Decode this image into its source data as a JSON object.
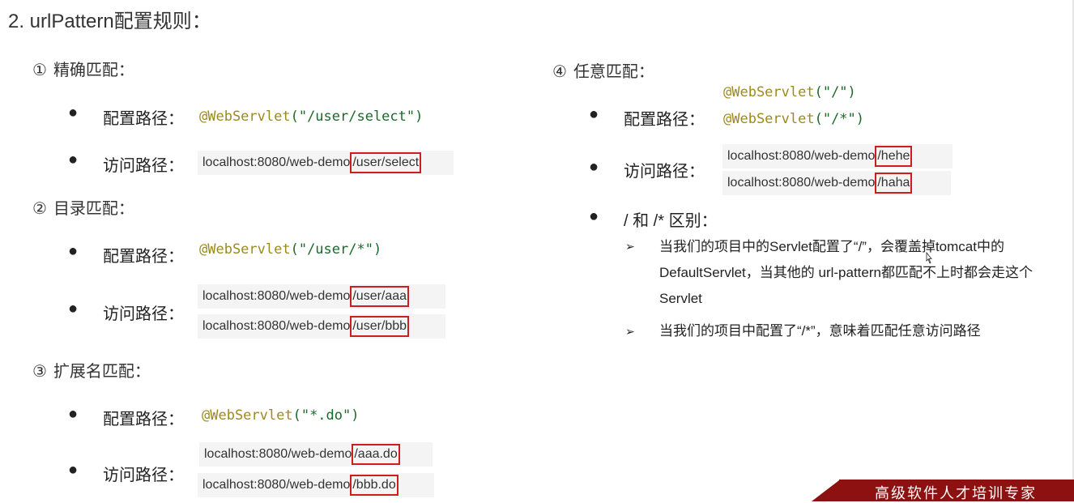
{
  "title": "2. urlPattern配置规则：",
  "sections": [
    {
      "num": "①",
      "heading": "精确匹配：",
      "config_label": "配置路径：",
      "config_lines": [
        {
          "anno": "@WebServlet",
          "arg": "(\"/user/select\")"
        }
      ],
      "access_label": "访问路径：",
      "urls": [
        {
          "host": "localhost:8080/web-demo",
          "path": "/user/select"
        }
      ]
    },
    {
      "num": "②",
      "heading": "目录匹配：",
      "config_label": "配置路径：",
      "config_lines": [
        {
          "anno": "@WebServlet",
          "arg": "(\"/user/*\")"
        }
      ],
      "access_label": "访问路径：",
      "urls": [
        {
          "host": "localhost:8080/web-demo",
          "path": "/user/aaa"
        },
        {
          "host": "localhost:8080/web-demo",
          "path": "/user/bbb"
        }
      ]
    },
    {
      "num": "③",
      "heading": "扩展名匹配：",
      "config_label": "配置路径：",
      "config_lines": [
        {
          "anno": "@WebServlet",
          "arg": "(\"*.do\")"
        }
      ],
      "access_label": "访问路径：",
      "urls": [
        {
          "host": "localhost:8080/web-demo",
          "path": "/aaa.do"
        },
        {
          "host": "localhost:8080/web-demo",
          "path": "/bbb.do"
        }
      ]
    },
    {
      "num": "④",
      "heading": "任意匹配：",
      "config_label": "配置路径：",
      "config_lines": [
        {
          "anno": "@WebServlet",
          "arg": "(\"/\")"
        },
        {
          "anno": "@WebServlet",
          "arg": "(\"/*\")"
        }
      ],
      "access_label": "访问路径：",
      "urls": [
        {
          "host": "localhost:8080/web-demo",
          "path": "/hehe"
        },
        {
          "host": "localhost:8080/web-demo",
          "path": "/haha"
        }
      ],
      "diff_label": "/ 和 /* 区别：",
      "notes": [
        "当我们的项目中的Servlet配置了“/”，会覆盖掉tomcat中的DefaultServlet，当其他的 url-pattern都匹配不上时都会走这个Servlet",
        "当我们的项目中配置了“/*”，意味着匹配任意访问路径"
      ]
    }
  ],
  "brand": {
    "text": "高级软件人才培训专家",
    "color": "#8e1111"
  },
  "colors": {
    "annotation": "#9c8a1e",
    "string": "#1a6a2a",
    "highlight_border": "#cc1e1e"
  }
}
